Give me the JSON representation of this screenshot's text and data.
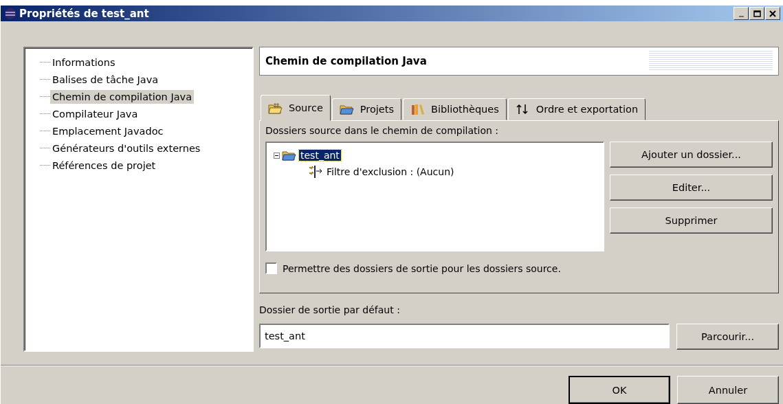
{
  "window": {
    "title": "Propriétés de test_ant",
    "controls": [
      {
        "kind": "minimize",
        "disabled": true
      },
      {
        "kind": "maximize",
        "disabled": false
      },
      {
        "kind": "close",
        "disabled": false
      }
    ]
  },
  "sidebar": {
    "items": [
      {
        "label": "Informations",
        "selected": false
      },
      {
        "label": "Balises de tâche Java",
        "selected": false
      },
      {
        "label": "Chemin de compilation Java",
        "selected": true
      },
      {
        "label": "Compilateur Java",
        "selected": false
      },
      {
        "label": "Emplacement Javadoc",
        "selected": false
      },
      {
        "label": "Générateurs d'outils externes",
        "selected": false
      },
      {
        "label": "Références de projet",
        "selected": false
      }
    ]
  },
  "page_title": "Chemin de compilation Java",
  "tabs": [
    {
      "label": "Source",
      "kind": "source",
      "selected": true
    },
    {
      "label": "Projets",
      "kind": "projects",
      "selected": false
    },
    {
      "label": "Bibliothèques",
      "kind": "libraries",
      "selected": false
    },
    {
      "label": "Ordre et exportation",
      "kind": "order",
      "selected": false
    }
  ],
  "source_folders": {
    "label": "Dossiers source dans le chemin de compilation :",
    "tree": [
      {
        "label": "test_ant",
        "kind": "folder",
        "expanded": true,
        "selected": true,
        "children": [
          {
            "label": "Filtre d'exclusion : (Aucun)",
            "kind": "filter",
            "selected": false
          }
        ]
      }
    ],
    "buttons": [
      "Ajouter un dossier...",
      "Editer...",
      "Supprimer"
    ]
  },
  "allow_output_folders": {
    "label": "Permettre des dossiers de sortie pour les dossiers source.",
    "checked": false
  },
  "default_output": {
    "label": "Dossier de sortie par défaut :",
    "value": "test_ant",
    "button": "Parcourir..."
  },
  "buttons": [
    "OK",
    "Annuler"
  ]
}
